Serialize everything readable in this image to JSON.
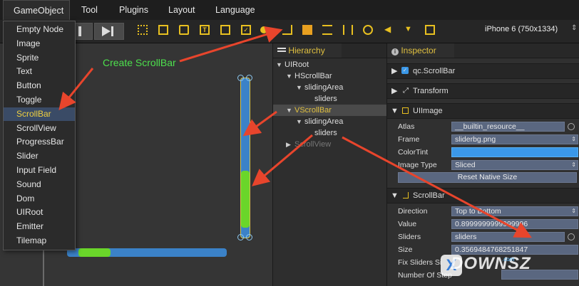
{
  "menubar": {
    "items": [
      {
        "label": "GameObject",
        "active": true
      },
      {
        "label": "Tool"
      },
      {
        "label": "Plugins"
      },
      {
        "label": "Layout"
      },
      {
        "label": "Language"
      }
    ]
  },
  "toolbar": {
    "device": "iPhone 6 (750x1334)",
    "device_arrow": "⇕"
  },
  "dropdown": {
    "items": [
      "Empty Node",
      "Image",
      "Sprite",
      "Text",
      "Button",
      "Toggle",
      "ScrollBar",
      "ScrollView",
      "ProgressBar",
      "Slider",
      "Input Field",
      "Sound",
      "Dom",
      "UIRoot",
      "Emitter",
      "Tilemap"
    ],
    "selected_index": 6
  },
  "annotation": {
    "label": "Create ScrollBar",
    "color": "#4de04d"
  },
  "scrollbars": {
    "vertical_value": 0.9,
    "vertical_size": 0.357,
    "horizontal_size": 0.2
  },
  "hierarchy": {
    "tab": "Hierarchy",
    "rows": [
      {
        "label": "UIRoot",
        "caret": "▼",
        "level": 0
      },
      {
        "label": "HScrollBar",
        "caret": "▼",
        "level": 1
      },
      {
        "label": "slidingArea",
        "caret": "▼",
        "level": 2
      },
      {
        "label": "sliders",
        "caret": "",
        "level": 3
      },
      {
        "label": "VScrollBar",
        "caret": "▼",
        "level": 1,
        "selected": true
      },
      {
        "label": "slidingArea",
        "caret": "▼",
        "level": 2
      },
      {
        "label": "sliders",
        "caret": "",
        "level": 3
      },
      {
        "label": "ScrollView",
        "caret": "▶",
        "level": 1,
        "dim": true
      }
    ]
  },
  "inspector": {
    "tab": "Inspector",
    "object_name": "qc.ScrollBar",
    "transform_label": "Transform",
    "uiimage": {
      "header": "UIImage",
      "atlas_label": "Atlas",
      "atlas_value": "__builtin_resource__",
      "frame_label": "Frame",
      "frame_value": "sliderbg.png",
      "colortint_label": "ColorTint",
      "colortint_value": "#3b98e8",
      "imagetype_label": "Image Type",
      "imagetype_value": "Sliced",
      "reset_label": "Reset Native Size"
    },
    "scrollbar": {
      "header": "ScrollBar",
      "direction_label": "Direction",
      "direction_value": "Top to Bottom",
      "value_label": "Value",
      "value_value": "0.8999999999999996",
      "sliders_label": "Sliders",
      "sliders_value": "sliders",
      "size_label": "Size",
      "size_value": "0.3569484768251847",
      "fix_label": "Fix Sliders Si",
      "steps_label": "Number Of Step"
    }
  },
  "watermark": {
    "text": "DOWNSZ",
    "sub": ".com"
  }
}
